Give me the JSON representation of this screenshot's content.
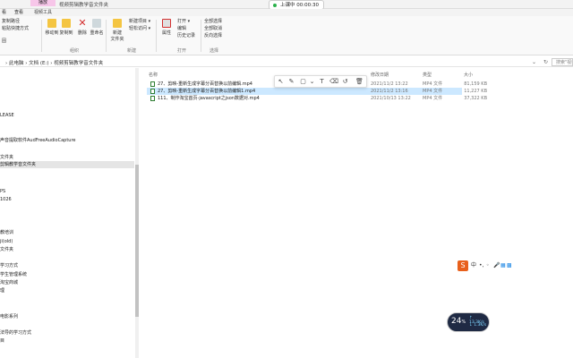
{
  "titlebar": {
    "context_tab": "播放",
    "window_title": "视频剪辑教学音文件夹",
    "recording_label": "上课中 00:00:30"
  },
  "tabs": [
    "看",
    "查看",
    "视频工具"
  ],
  "ribbon": {
    "clipboard": {
      "copy_path": "复制路径",
      "paste_shortcut": "粘贴快捷方式",
      "pin": "固",
      "group": "组织"
    },
    "organize": {
      "move_to": "移动到",
      "copy_to": "复制到",
      "delete": "删除",
      "rename": "重命名",
      "group": "组织"
    },
    "new": {
      "new_folder": "新建\n文件夹",
      "new_item": "新建项目 ▾",
      "easy_access": "轻松访问 ▾",
      "group": "新建"
    },
    "open": {
      "properties": "属性",
      "open": "打开 ▾",
      "edit": "编辑",
      "history": "历史记录",
      "group": "打开"
    },
    "select": {
      "select_all": "全部选择",
      "select_none": "全部取消",
      "invert": "反向选择",
      "group": "选择"
    }
  },
  "address": {
    "crumbs": "› 此电脑 › 文档 (E:) › 视频剪辑教学音文件夹",
    "search_placeholder": "搜索\"视频剪辑",
    "refresh": "↻",
    "dropdown": "⌄"
  },
  "sidebar": {
    "items": [
      {
        "label": "LEASE",
        "selected": false
      },
      {
        "label": "声音提取软件AudFreeAudioCapture",
        "selected": false
      },
      {
        "label": "文件夹",
        "selected": false
      },
      {
        "label": "剪辑教学音文件夹",
        "selected": true
      },
      {
        "label": "PS",
        "selected": false
      },
      {
        "label": "1026",
        "selected": false
      },
      {
        "label": "教培训",
        "selected": false
      },
      {
        "label": "ji(old)",
        "selected": false
      },
      {
        "label": "文件夹",
        "selected": false
      },
      {
        "label": "学习方式",
        "selected": false
      },
      {
        "label": "学生管理系统",
        "selected": false
      },
      {
        "label": "淘宝商城",
        "selected": false
      },
      {
        "label": "理",
        "selected": false
      },
      {
        "label": "电影系列",
        "selected": false
      },
      {
        "label": "法导的学习方式",
        "selected": false
      },
      {
        "label": "目",
        "selected": false
      }
    ]
  },
  "filelist": {
    "columns": {
      "name": "名称",
      "date": "修改日期",
      "type": "类型",
      "size": "大小"
    },
    "rows": [
      {
        "name": "27、剪映-重新生成字幕分百替换以前编辑.mp4",
        "date": "2021/11/2 13:22",
        "type": "MP4 文件",
        "size": "81,159 KB",
        "selected": false
      },
      {
        "name": "27、剪映-重新生成字幕分百替换以前编辑1.mp4",
        "date": "2021/11/2 13:16",
        "type": "MP4 文件",
        "size": "11,227 KB",
        "selected": true
      },
      {
        "name": "111、制作淘宝首页-javascript之json数据对.mp4",
        "date": "2021/10/13 13:22",
        "type": "MP4 文件",
        "size": "37,322 KB",
        "selected": false
      }
    ]
  },
  "annotation_toolbar": [
    "↖",
    "✎",
    "▢",
    "⌄",
    "T",
    "⌫",
    "↺",
    "🗑"
  ],
  "ime": {
    "logo": "S",
    "mode": "中",
    "items": [
      "•,",
      "◦",
      "🎤",
      "▦",
      "▩"
    ]
  },
  "speed": {
    "value": "24",
    "unit": "%",
    "up": "↑ 13.3K/s",
    "down": "↓ 1.3K/s"
  }
}
